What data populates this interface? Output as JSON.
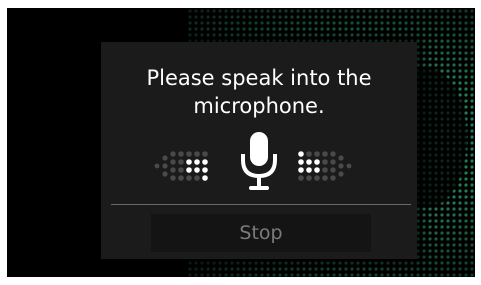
{
  "dialog": {
    "prompt_line1": "Please speak into the",
    "prompt_line2": "microphone.",
    "stop_label": "Stop"
  },
  "icons": {
    "microphone": "microphone-icon",
    "level_left": "audio-level-left-icon",
    "level_right": "audio-level-right-icon"
  },
  "colors": {
    "dialog_background": "#1b1b1b",
    "text": "#ffffff",
    "stop_text": "#7c7c7c",
    "stop_background": "#141414",
    "background_dots_left": "#2ca05a",
    "background_dots_right": "#2f6fd0"
  }
}
